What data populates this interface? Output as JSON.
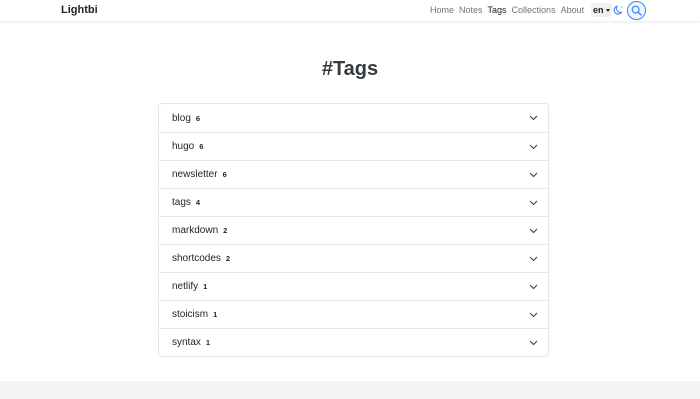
{
  "navbar": {
    "brand": "Lightbi",
    "links": [
      {
        "label": "Home"
      },
      {
        "label": "Notes"
      },
      {
        "label": "Tags"
      },
      {
        "label": "Collections"
      },
      {
        "label": "About"
      }
    ],
    "active_link": "Tags",
    "language": "en",
    "theme_icon": "moon-icon",
    "search_icon": "search-icon"
  },
  "page": {
    "title": "#Tags"
  },
  "tags": [
    {
      "name": "blog",
      "count": "6"
    },
    {
      "name": "hugo",
      "count": "6"
    },
    {
      "name": "newsletter",
      "count": "6"
    },
    {
      "name": "tags",
      "count": "4"
    },
    {
      "name": "markdown",
      "count": "2"
    },
    {
      "name": "shortcodes",
      "count": "2"
    },
    {
      "name": "netlify",
      "count": "1"
    },
    {
      "name": "stoicism",
      "count": "1"
    },
    {
      "name": "syntax",
      "count": "1"
    }
  ],
  "colors": {
    "accent": "#3b82f6",
    "text": "#212529",
    "muted": "#6c757d",
    "border": "#e5e7eb"
  }
}
